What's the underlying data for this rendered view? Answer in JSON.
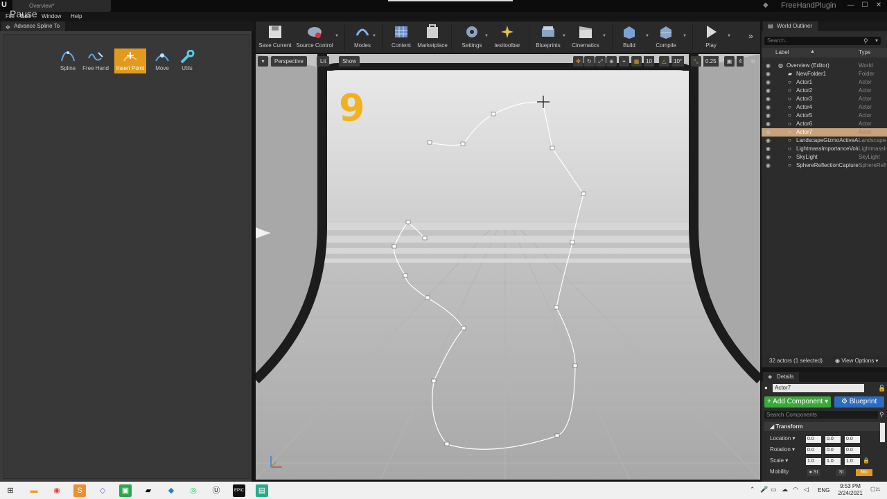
{
  "window": {
    "tab_title": "Overview*",
    "logo": "U",
    "pause_label": "Pause",
    "project_name": "FreeHandPlugin",
    "minimize": "—",
    "maximize": "☐",
    "close": "✕"
  },
  "menu": {
    "items": [
      "File",
      "Edit",
      "Window",
      "Help"
    ]
  },
  "left_panel": {
    "tab_label": "Advance Spline To",
    "modes": [
      {
        "label": "Spline",
        "icon": "spline-icon"
      },
      {
        "label": "Free Hand",
        "icon": "freehand-icon"
      },
      {
        "label": "Insert Point",
        "icon": "insert-point-icon",
        "active": true
      },
      {
        "label": "Move",
        "icon": "move-icon"
      },
      {
        "label": "Utils",
        "icon": "utils-icon"
      }
    ]
  },
  "toolbar": {
    "buttons": [
      {
        "label": "Save Current",
        "icon": "save-icon"
      },
      {
        "label": "Source Control",
        "icon": "source-control-icon"
      },
      {
        "label": "Modes",
        "icon": "modes-icon"
      },
      {
        "label": "Content",
        "icon": "content-icon"
      },
      {
        "label": "Marketplace",
        "icon": "marketplace-icon"
      },
      {
        "label": "Settings",
        "icon": "settings-icon"
      },
      {
        "label": "testtoolbar",
        "icon": "testtoolbar-icon"
      },
      {
        "label": "Blueprints",
        "icon": "blueprints-icon"
      },
      {
        "label": "Cinematics",
        "icon": "cinematics-icon"
      },
      {
        "label": "Build",
        "icon": "build-icon"
      },
      {
        "label": "Compile",
        "icon": "compile-icon"
      },
      {
        "label": "Play",
        "icon": "play-icon"
      }
    ],
    "more": "»"
  },
  "viewport": {
    "perspective_label": "Perspective",
    "lit_label": "Lit",
    "show_label": "Show",
    "grid_snap_value": "10",
    "rotation_snap_value": "10°",
    "scale_snap_value": "0.25",
    "camera_speed_value": "4",
    "level_number": "9"
  },
  "world_outliner": {
    "tab_label": "World Outliner",
    "search_placeholder": "Search...",
    "col_label": "Label",
    "col_type": "Type",
    "rows": [
      {
        "name": "Overview (Editor)",
        "type": "World",
        "indent": 0
      },
      {
        "name": "NewFolder1",
        "type": "Folder",
        "indent": 1
      },
      {
        "name": "Actor1",
        "type": "Actor",
        "indent": 1
      },
      {
        "name": "Actor2",
        "type": "Actor",
        "indent": 1
      },
      {
        "name": "Actor3",
        "type": "Actor",
        "indent": 1
      },
      {
        "name": "Actor4",
        "type": "Actor",
        "indent": 1
      },
      {
        "name": "Actor5",
        "type": "Actor",
        "indent": 1
      },
      {
        "name": "Actor6",
        "type": "Actor",
        "indent": 1
      },
      {
        "name": "Actor7",
        "type": "Actor",
        "indent": 1,
        "selected": true
      },
      {
        "name": "LandscapeGizmoActiveActor",
        "type": "LandscapeGizmoActiveActor",
        "indent": 1
      },
      {
        "name": "LightmassImportanceVolume",
        "type": "LightmassImportanceVolume",
        "indent": 1
      },
      {
        "name": "SkyLight",
        "type": "SkyLight",
        "indent": 1
      },
      {
        "name": "SphereReflectionCapture",
        "type": "SphereReflectionCapture",
        "indent": 1
      }
    ],
    "actor_count": "32 actors (1 selected)",
    "view_options": "View Options"
  },
  "details": {
    "tab_label": "Details",
    "actor_name": "Actor7",
    "add_component": "+ Add Component",
    "blueprint": "Blueprint",
    "search_placeholder": "Search Components",
    "transform_header": "Transform",
    "location_label": "Location",
    "rotation_label": "Rotation",
    "scale_label": "Scale",
    "mobility_label": "Mobility",
    "location": [
      "0.0",
      "0.0",
      "0.0"
    ],
    "rotation": [
      "0.0",
      "0.0",
      "0.0"
    ],
    "scale": [
      "1.0",
      "1.0",
      "1.0"
    ],
    "mobility": [
      "St",
      "St",
      "Mo"
    ]
  },
  "taskbar": {
    "time": "9:53 PM",
    "date": "2/24/2021",
    "language": "ENG",
    "notification_count": "21",
    "apps": [
      "windows-start-icon",
      "file-explorer-icon",
      "chrome-icon",
      "sublime-icon",
      "visual-studio-icon",
      "green-app-icon",
      "terminal-icon",
      "blue-app-icon",
      "whatsapp-icon",
      "unreal-icon",
      "epic-games-icon",
      "app-icon"
    ]
  },
  "colors": {
    "accent_orange": "#e39a1c",
    "selection": "#c8a27a",
    "add_component_green": "#3aa83a",
    "blueprint_blue": "#2d6bc0",
    "level_number_yellow": "#f2b21e"
  }
}
